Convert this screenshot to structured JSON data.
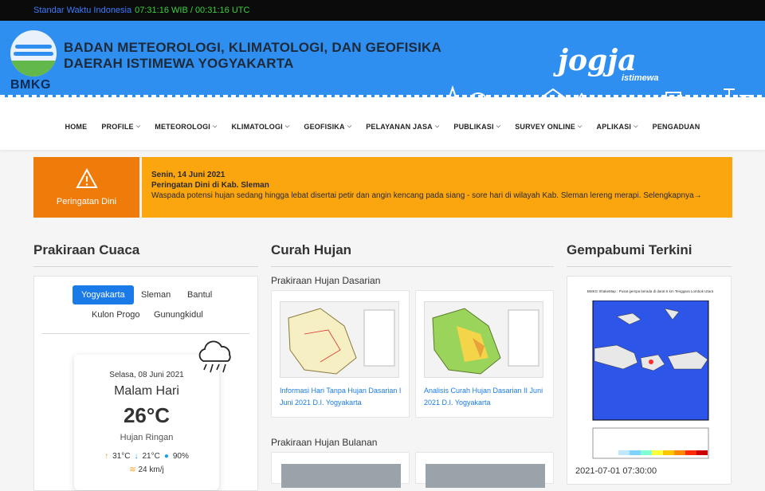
{
  "topbar": {
    "label": "Standar Waktu Indonesia",
    "clock": "07:31:16 WIB / 00:31:16 UTC"
  },
  "header": {
    "logo_text": "BMKG",
    "org_line1": "BADAN METEOROLOGI, KLIMATOLOGI, DAN GEOFISIKA",
    "org_line2": "DAERAH ISTIMEWA YOGYAKARTA",
    "jogja": "jogja",
    "jogja_sub": "istimewa"
  },
  "nav": [
    {
      "label": "HOME",
      "dropdown": false
    },
    {
      "label": "PROFILE",
      "dropdown": true
    },
    {
      "label": "METEOROLOGI",
      "dropdown": true
    },
    {
      "label": "KLIMATOLOGI",
      "dropdown": true
    },
    {
      "label": "GEOFISIKA",
      "dropdown": true
    },
    {
      "label": "PELAYANAN JASA",
      "dropdown": true
    },
    {
      "label": "PUBLIKASI",
      "dropdown": true
    },
    {
      "label": "SURVEY ONLINE",
      "dropdown": true
    },
    {
      "label": "APLIKASI",
      "dropdown": true
    },
    {
      "label": "PENGADUAN",
      "dropdown": false
    }
  ],
  "alert": {
    "badge_label": "Peringatan Dini",
    "date": "Senin, 14 Juni 2021",
    "title": "Peringatan Dini di Kab. Sleman",
    "text": "Waspada potensi hujan sedang hingga lebat disertai petir dan angin kencang pada siang - sore hari di wilayah Kab. Sleman lereng merapi. Selengkapnya→"
  },
  "forecast": {
    "title": "Prakiraan Cuaca",
    "tabs": [
      "Yogyakarta",
      "Sleman",
      "Bantul",
      "Kulon Progo",
      "Gunungkidul"
    ],
    "active_tab": "Yogyakarta",
    "date": "Selasa, 08 Juni 2021",
    "period": "Malam Hari",
    "temperature": "26°C",
    "condition": "Hujan Ringan",
    "max_temp": "31°C",
    "min_temp": "21°C",
    "humidity": "90%",
    "wind": "24 km/j"
  },
  "rainfall": {
    "title": "Curah Hujan",
    "daily_heading": "Prakiraan Hujan Dasarian",
    "daily_items": [
      {
        "caption": "Informasi Hari Tanpa Hujan Dasarian I Juni 2021 D.I. Yogyakarta"
      },
      {
        "caption": "Analisis Curah Hujan Dasarian II Juni 2021 D.I. Yogyakarta"
      }
    ],
    "monthly_heading": "Prakiraan Hujan Bulanan"
  },
  "earthquake": {
    "title": "Gempabumi Terkini",
    "map_title": "BMKG ShakeMap : Pusat gempa berada di darat 6 km Tenggara Lombok Utara",
    "timestamp": "2021-07-01 07:30:00"
  },
  "colors": {
    "primary_blue": "#2e8ff0",
    "alert_orange": "#ef7b0b",
    "alert_yellow": "#fba60f",
    "tab_active": "#1a7be8"
  }
}
